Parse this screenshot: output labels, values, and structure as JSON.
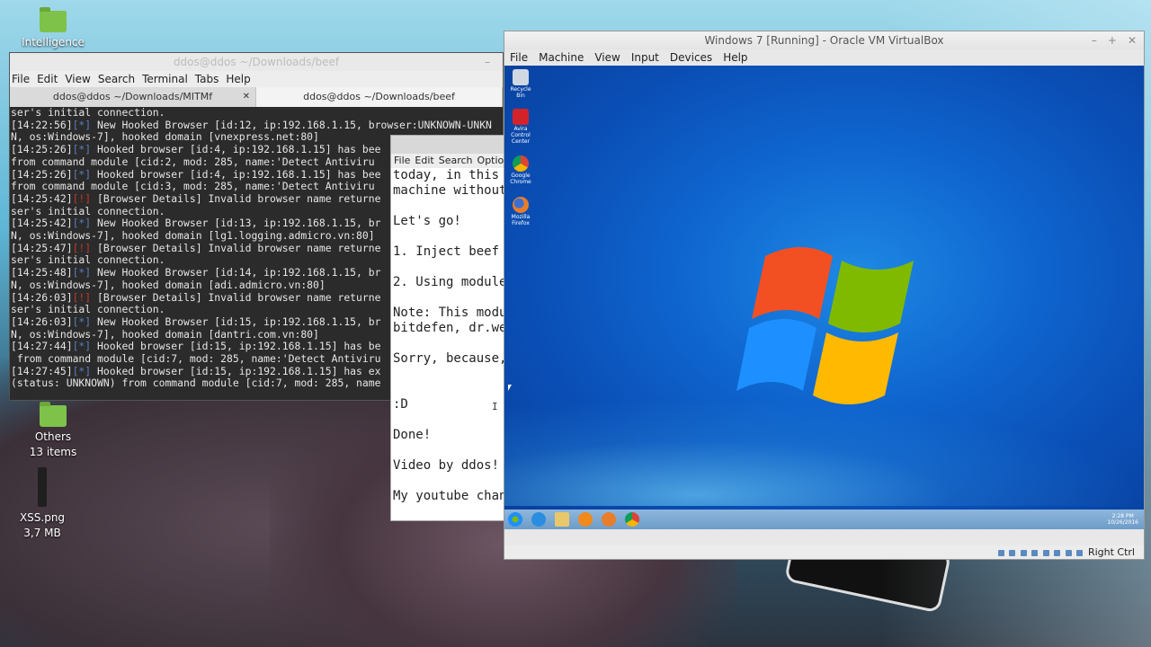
{
  "desktop": {
    "icons": [
      {
        "label": "Intelligence"
      },
      {
        "label": "Others",
        "sub": "13 items"
      },
      {
        "label": "XSS.png",
        "sub": "3,7 MB"
      }
    ]
  },
  "terminal": {
    "title": "ddos@ddos ~/Downloads/beef",
    "menu": [
      "File",
      "Edit",
      "View",
      "Search",
      "Terminal",
      "Tabs",
      "Help"
    ],
    "tabs": [
      {
        "label": "ddos@ddos ~/Downloads/MITMf"
      },
      {
        "label": "ddos@ddos ~/Downloads/beef"
      }
    ],
    "lines": [
      "ser's initial connection.",
      "[14:22:56][*] New Hooked Browser [id:12, ip:192.168.1.15, browser:UNKNOWN-UNKN",
      "N, os:Windows-7], hooked domain [vnexpress.net:80]",
      "[14:25:26][*] Hooked browser [id:4, ip:192.168.1.15] has bee",
      "from command module [cid:2, mod: 285, name:'Detect Antiviru",
      "[14:25:26][*] Hooked browser [id:4, ip:192.168.1.15] has bee",
      "from command module [cid:3, mod: 285, name:'Detect Antiviru",
      "[14:25:42][!] [Browser Details] Invalid browser name returne",
      "ser's initial connection.",
      "[14:25:42][*] New Hooked Browser [id:13, ip:192.168.1.15, br",
      "N, os:Windows-7], hooked domain [lg1.logging.admicro.vn:80]",
      "[14:25:47][!] [Browser Details] Invalid browser name returne",
      "ser's initial connection.",
      "[14:25:48][*] New Hooked Browser [id:14, ip:192.168.1.15, br",
      "N, os:Windows-7], hooked domain [adi.admicro.vn:80]",
      "[14:26:03][!] [Browser Details] Invalid browser name returne",
      "ser's initial connection.",
      "[14:26:03][*] New Hooked Browser [id:15, ip:192.168.1.15, br",
      "N, os:Windows-7], hooked domain [dantri.com.vn:80]",
      "[14:27:44][*] Hooked browser [id:15, ip:192.168.1.15] has be",
      " from command module [cid:7, mod: 285, name:'Detect Antiviru",
      "[14:27:45][*] Hooked browser [id:15, ip:192.168.1.15] has ex",
      "(status: UNKNOWN) from command module [cid:7, mod: 285, name",
      ""
    ]
  },
  "editor": {
    "menu": [
      "File",
      "Edit",
      "Search",
      "Options"
    ],
    "lines": [
      "today, in this",
      "machine without",
      "",
      "Let's go!",
      "",
      "1. Inject beef",
      "",
      "2. Using module",
      "",
      "Note: This modu",
      "bitdefen, dr.we",
      "",
      "Sorry, because,",
      "",
      "",
      ":D",
      "",
      "Done!",
      "",
      "Video by ddos!",
      "",
      "My youtube chan"
    ]
  },
  "vbox": {
    "title": "Windows 7 [Running] - Oracle VM VirtualBox",
    "menu": [
      "File",
      "Machine",
      "View",
      "Input",
      "Devices",
      "Help"
    ],
    "status_host_key": "Right Ctrl",
    "guest": {
      "desktop_icons": [
        {
          "label": "Recycle Bin",
          "color": "#cfd8e3"
        },
        {
          "label": "Avira Control Center",
          "color": "#d2232a"
        },
        {
          "label": "Google Chrome",
          "color": "#e0b93a"
        },
        {
          "label": "Mozilla Firefox",
          "color": "#e87e2a"
        }
      ],
      "clock_time": "2:28 PM",
      "clock_date": "10/26/2016"
    }
  }
}
